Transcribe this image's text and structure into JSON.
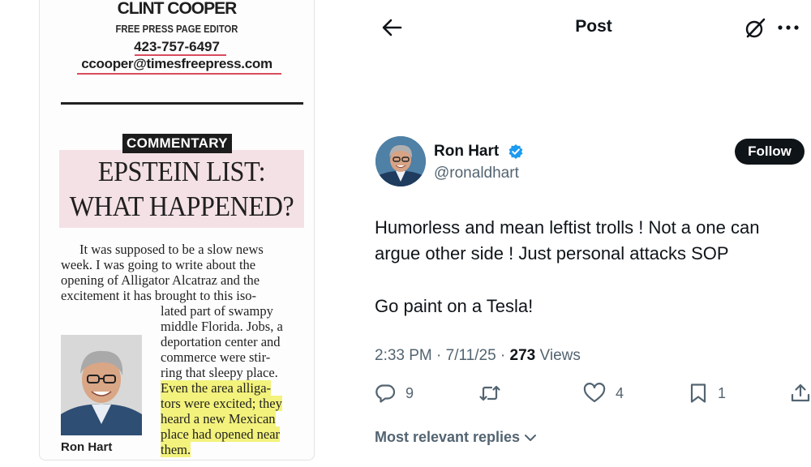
{
  "clipping": {
    "editor_name": "CLINT COOPER",
    "editor_role": "FREE PRESS PAGE EDITOR",
    "phone": "423-757-6497",
    "email": "ccooper@timesfreepress.com",
    "section": "COMMENTARY",
    "headline_line1": "EPSTEIN LIST:",
    "headline_line2": "WHAT HAPPENED?",
    "body_lines": [
      "It was supposed to be a slow news",
      "week. I was going to write about the",
      "opening of Alligator Alcatraz and the",
      "excitement it has brought to this iso-",
      "lated part of swampy",
      "middle Florida. Jobs, a",
      "deportation center and",
      "commerce were stir-",
      "ring that sleepy place.",
      "Even the area alliga-",
      "tors were excited; they",
      "heard a new Mexican",
      "place had opened near",
      "them."
    ],
    "photo_caption": "Ron Hart"
  },
  "post": {
    "header_title": "Post",
    "author": {
      "display_name": "Ron Hart",
      "handle": "@ronaldhart",
      "verified": true
    },
    "follow_label": "Follow",
    "text_line1": "Humorless and mean leftist trolls !  Not a one can",
    "text_line2": "argue other side ! Just personal attacks    SOP",
    "text_line3": "Go paint on a Tesla!",
    "time": "2:33 PM",
    "date": "7/11/25",
    "views_count": "273",
    "views_label": "Views",
    "replies": "9",
    "likes": "4",
    "bookmarks": "1",
    "replies_sort": "Most relevant replies"
  },
  "icons": {
    "back": "back-arrow-icon",
    "grok": "grok-icon",
    "more": "more-dots-icon",
    "verified": "verified-badge-icon",
    "reply": "reply-icon",
    "repost": "repost-icon",
    "like": "heart-icon",
    "bookmark": "bookmark-icon",
    "share": "share-icon",
    "chevron": "chevron-down-icon"
  },
  "colors": {
    "verified_blue": "#1d9bf0",
    "text_primary": "#0f1419",
    "text_secondary": "#536471",
    "highlight": "#f3f27c",
    "headline_bg": "#f4e1e5"
  }
}
